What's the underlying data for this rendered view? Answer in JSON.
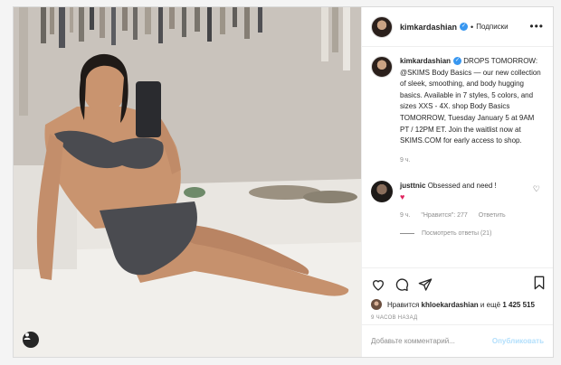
{
  "post": {
    "username": "kimkardashian",
    "follow_label": "Подписки",
    "more_label": "•••",
    "caption": "DROPS TOMORROW: @SKIMS Body Basics — our new collection of sleek, smoothing, and body hugging basics. Available in 7 styles, 5 colors, and sizes XXS - 4X. shop Body Basics TOMORROW, Tuesday January 5 at 9AM PT / 12PM ET. Join the waitlist now at SKIMS.COM for early access to shop.",
    "caption_time": "9 ч.",
    "comment": {
      "username": "justtnic",
      "text": "Obsessed and need !",
      "emoji": "♥",
      "time": "9 ч.",
      "likes_label": "\"Нравится\": 277",
      "reply_label": "Ответить"
    },
    "view_replies": "Посмотреть ответы (21)",
    "likes_prefix": "Нравится",
    "likes_user": "khloekardashian",
    "likes_suffix": "и ещё",
    "likes_count": "1 425 515",
    "posted_ago": "9 ЧАСОВ НАЗАД",
    "add_comment_placeholder": "Добавьте комментарий...",
    "publish_label": "Опубликовать"
  },
  "colors": {
    "verified": "#3897f0",
    "heart": "#e0245e",
    "publish_disabled": "#b2dffc"
  }
}
